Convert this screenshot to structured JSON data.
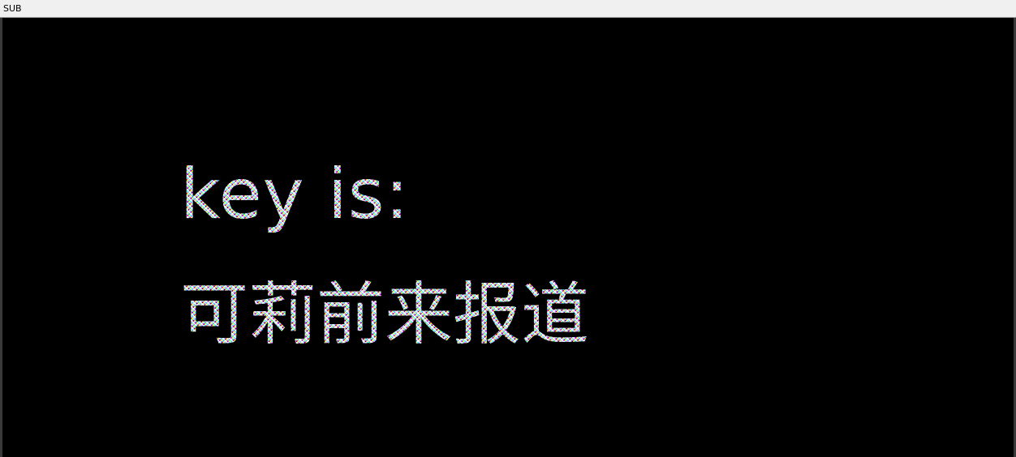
{
  "window": {
    "title": "SUB"
  },
  "content": {
    "line1": "key is:",
    "line2": "可莉前来报道"
  },
  "colors": {
    "background": "#000000",
    "titlebar": "#f0f0f0",
    "text_noise": [
      "#ff3b3b",
      "#2bff5b",
      "#3b6bff",
      "#ffffff",
      "#ff48e0",
      "#27e8ff",
      "#f8ff3a",
      "#b15cff"
    ]
  }
}
